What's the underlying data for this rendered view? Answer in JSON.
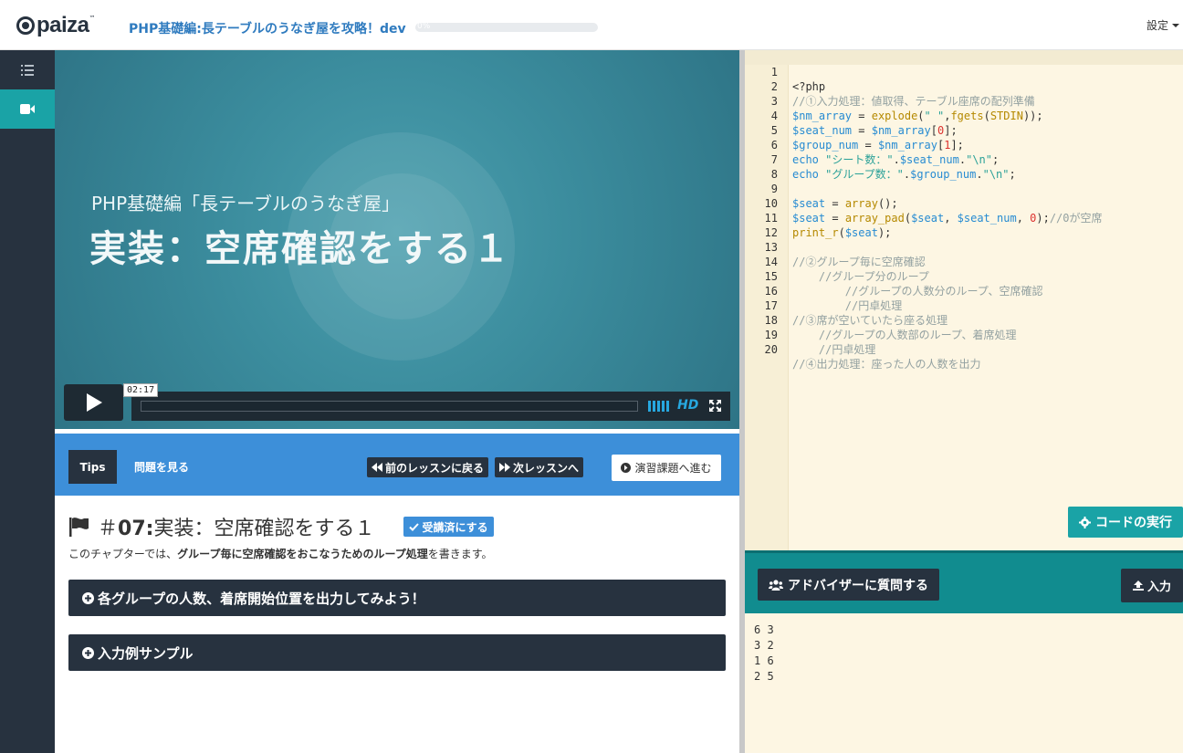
{
  "header": {
    "logo_text": "paiza",
    "logo_tm": "™",
    "course_title": "PHP基礎編:長テーブルのうなぎ屋を攻略！dev",
    "progress_label": "0%",
    "progress_value": 0,
    "settings_label": "設定"
  },
  "sidebar": {
    "items": [
      {
        "icon": "list-icon",
        "active": false
      },
      {
        "icon": "video-camera-icon",
        "active": true
      }
    ]
  },
  "video": {
    "subtitle": "PHP基礎編「長テーブルのうなぎ屋」",
    "title": "実装：空席確認をする１",
    "time_tooltip": "02:17",
    "hd_label": "HD"
  },
  "tabs": {
    "tips_label": "Tips",
    "problem_label": "問題を見る",
    "prev_label": "前のレッスンに戻る",
    "next_label": "次レッスンへ",
    "exercise_label": "演習課題へ進む"
  },
  "lesson": {
    "number_prefix": "＃",
    "number": "07:",
    "title": "実装：空席確認をする１",
    "done_label": "受講済にする",
    "desc_pre": "このチャプターでは、",
    "desc_bold": "グループ毎に空席確認をおこなうためのループ処理",
    "desc_post": "を書きます。",
    "accordion1": "各グループの人数、着席開始位置を出力してみよう！",
    "accordion2": "入力例サンプル"
  },
  "editor": {
    "lines": [
      "1",
      "2",
      "3",
      "4",
      "5",
      "6",
      "7",
      "8",
      "9",
      "10",
      "11",
      "12",
      "13",
      "14",
      "15",
      "16",
      "17",
      "18",
      "19",
      "20"
    ],
    "code": {
      "l1": "<?php",
      "l2": "//①入力処理：値取得、テーブル座席の配列準備",
      "l3_var": "$nm_array",
      "l3_eq": " = ",
      "l3_fn": "explode",
      "l3_p1": "(",
      "l3_str": "\" \"",
      "l3_p2": ",",
      "l3_fn2": "fgets",
      "l3_p3": "(",
      "l3_const": "STDIN",
      "l3_p4": "));",
      "l4_var": "$seat_num",
      "l4_eq": " = ",
      "l4_var2": "$nm_array",
      "l4_b1": "[",
      "l4_num": "0",
      "l4_b2": "];",
      "l5_var": "$group_num",
      "l5_eq": " = ",
      "l5_var2": "$nm_array",
      "l5_b1": "[",
      "l5_num": "1",
      "l5_b2": "];",
      "l6_kw": "echo",
      "l6_str": " \"シート数：\"",
      "l6_dot": ".",
      "l6_var": "$seat_num",
      "l6_dot2": ".",
      "l6_str2": "\"\\n\"",
      "l6_end": ";",
      "l7_kw": "echo",
      "l7_str": " \"グループ数：\"",
      "l7_dot": ".",
      "l7_var": "$group_num",
      "l7_dot2": ".",
      "l7_str2": "\"\\n\"",
      "l7_end": ";",
      "l9_var": "$seat",
      "l9_eq": " = ",
      "l9_fn": "array",
      "l9_end": "();",
      "l10_var": "$seat",
      "l10_eq": " = ",
      "l10_fn": "array_pad",
      "l10_p1": "(",
      "l10_v1": "$seat",
      "l10_c1": ", ",
      "l10_v2": "$seat_num",
      "l10_c2": ", ",
      "l10_num": "0",
      "l10_end": ");",
      "l10_com": "//0が空席",
      "l11_fn": "print_r",
      "l11_p1": "(",
      "l11_var": "$seat",
      "l11_end": ");",
      "l13": "//②グループ毎に空席確認",
      "l14": "    //グループ分のループ",
      "l15": "        //グループの人数分のループ、空席確認",
      "l16": "        //円卓処理",
      "l17": "//③席が空いていたら座る処理",
      "l18": "    //グループの人数部のループ、着席処理",
      "l19": "    //円卓処理",
      "l20": "//④出力処理：座った人の人数を出力"
    },
    "run_label": "コードの実行"
  },
  "io": {
    "advisor_label": "アドバイザーに質問する",
    "input_label": "入力",
    "input_lines": [
      "6 3",
      "3 2",
      "1 6",
      "2 5"
    ]
  },
  "colors": {
    "accent_teal": "#1aa3a6",
    "accent_blue": "#3d8fd9",
    "dark": "#27323f",
    "editor_bg": "#fdf6e3"
  }
}
